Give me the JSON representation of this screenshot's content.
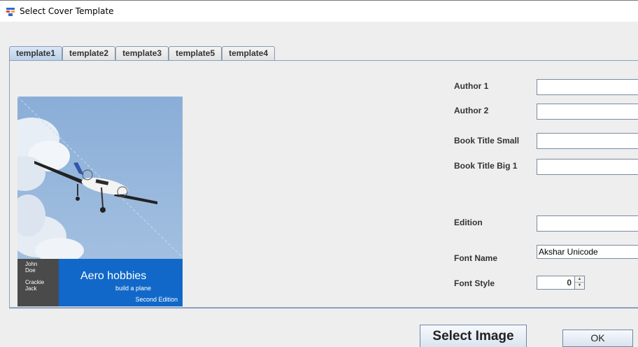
{
  "window": {
    "title": "Select Cover Template",
    "icon": "app-logo-icon"
  },
  "tabs": [
    {
      "label": "template1",
      "active": true
    },
    {
      "label": "template2",
      "active": false
    },
    {
      "label": "template3",
      "active": false
    },
    {
      "label": "template5",
      "active": false
    },
    {
      "label": "template4",
      "active": false
    }
  ],
  "cover": {
    "author1": "John Doe",
    "author2": "Crackie Jack",
    "title": "Aero hobbies",
    "subtitle": "build a plane",
    "edition": "Second Edition"
  },
  "form": {
    "author1_label": "Author 1",
    "author1_value": "",
    "author2_label": "Author 2",
    "author2_value": "",
    "title_small_label": "Book Title Small",
    "title_small_value": "",
    "title_big_label": "Book Title Big 1",
    "title_big_value": "",
    "edition_label": "Edition",
    "edition_value": "",
    "font_name_label": "Font Name",
    "font_name_value": "Akshar Unicode",
    "font_style_label": "Font Style",
    "font_style_value": "0"
  },
  "buttons": {
    "select_image": "Select Image",
    "ok": "OK"
  },
  "colors": {
    "cover_blue": "#1168c8",
    "cover_gray": "#4a4a4a",
    "sky": "#7aa3d4"
  }
}
